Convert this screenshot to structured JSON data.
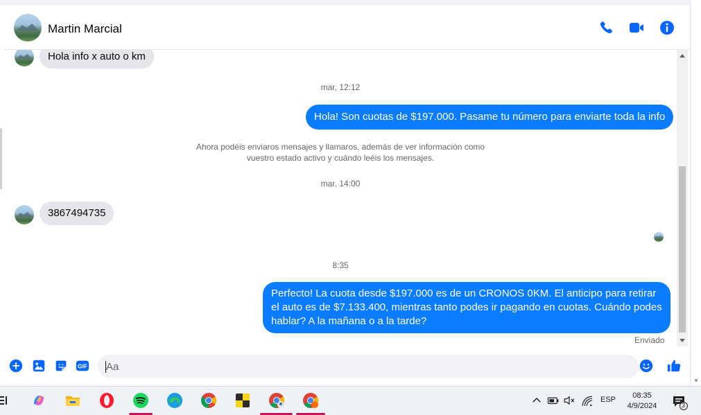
{
  "header": {
    "contact_name": "Martin Marcial"
  },
  "messages": {
    "first_incoming": "Hola info x auto o km",
    "stamp_1": "mar, 12:12",
    "outgoing_1": "Hola! Son cuotas de $197.000. Pasame tu número para enviarte toda la info",
    "system_note": "Ahora podéis enviaros mensajes y llamaros, además de ver información como vuestro estado activo y cuándo leéis los mensajes.",
    "stamp_2": "mar, 14:00",
    "incoming_2": "3867494735",
    "stamp_3": "8:35",
    "outgoing_2": "Perfecto! La cuota desde $197.000 es de un CRONOS 0KM. El anticipo para retirar el auto es de $7.133.400, mientras tanto podes ir pagando en cuotas. Cuándo podes hablar? A la mañana o a la tarde?",
    "status": "Enviado"
  },
  "composer": {
    "placeholder": "Aa"
  },
  "taskbar": {
    "language": "ESP",
    "time": "08:35",
    "date": "4/9/2024",
    "notifications_count": "3",
    "apps": [
      "task-view-icon",
      "copilot-icon",
      "file-explorer-icon",
      "opera-icon",
      "spotify-icon",
      "edge-icon",
      "chrome-icon",
      "sticky-notes-icon",
      "chrome-profile-icon",
      "chrome-profile-2-icon"
    ]
  },
  "colors": {
    "accent": "#0a7cff",
    "incoming_bubble": "#e4e6eb",
    "messenger_blue": "#0866ff"
  }
}
